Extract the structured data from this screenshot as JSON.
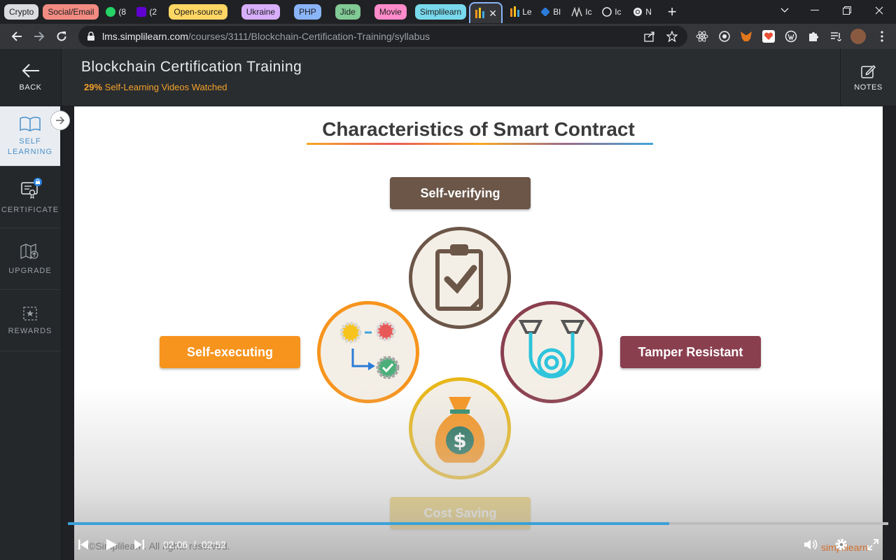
{
  "tabs": {
    "groups": [
      {
        "label": "Crypto",
        "color": "#dadce0"
      },
      {
        "label": "Social/Email",
        "color": "#f28b82"
      },
      {
        "label": "Open-source",
        "color": "#fdd663"
      },
      {
        "label": "Ukraine",
        "color": "#d7aefb"
      },
      {
        "label": "PHP",
        "color": "#8ab4f8"
      },
      {
        "label": "Jide",
        "color": "#81c995"
      },
      {
        "label": "Movie",
        "color": "#ff8bcb"
      },
      {
        "label": "Simplilearn",
        "color": "#78d9ec"
      }
    ],
    "whatsapp_label": "(8",
    "mail_label": "(2",
    "active_tab_icon": "simplilearn-bars-icon",
    "mini_tabs": [
      {
        "label": "Le",
        "icon": "simplilearn-bars-icon"
      },
      {
        "label": "Bl",
        "icon": "blockchain-cube-icon"
      },
      {
        "label": "Ic",
        "icon": "ic-logo-icon"
      },
      {
        "label": "Ic",
        "icon": "compass-icon"
      },
      {
        "label": "N",
        "icon": "chrome-icon"
      }
    ]
  },
  "address": {
    "host": "lms.simplilearn.com",
    "path": "/courses/3111/Blockchain-Certification-Training/syllabus"
  },
  "header": {
    "back_label": "BACK",
    "title": "Blockchain Certification Training",
    "progress_percent": "29%",
    "progress_text": "Self-Learning Videos Watched",
    "notes_label": "NOTES"
  },
  "sidebar": {
    "items": [
      {
        "line1": "SELF",
        "line2": "LEARNING"
      },
      {
        "line1": "CERTIFICATE"
      },
      {
        "line1": "UPGRADE"
      },
      {
        "line1": "REWARDS"
      }
    ]
  },
  "slide": {
    "title": "Characteristics of Smart Contract",
    "labels": {
      "top": "Self-verifying",
      "left": "Self-executing",
      "right": "Tamper Resistant",
      "bottom": "Cost Saving"
    },
    "colors": {
      "top": "#6b5648",
      "left": "#f7941d",
      "right": "#8a3f4f",
      "bottom": "#e8b718"
    },
    "copyright": "©Simplilearn. All rights reserved.",
    "brand": "simplilearn"
  },
  "player": {
    "current_time": "02:06",
    "separator": "/",
    "duration": "02:52",
    "progress_fraction": 0.733
  }
}
